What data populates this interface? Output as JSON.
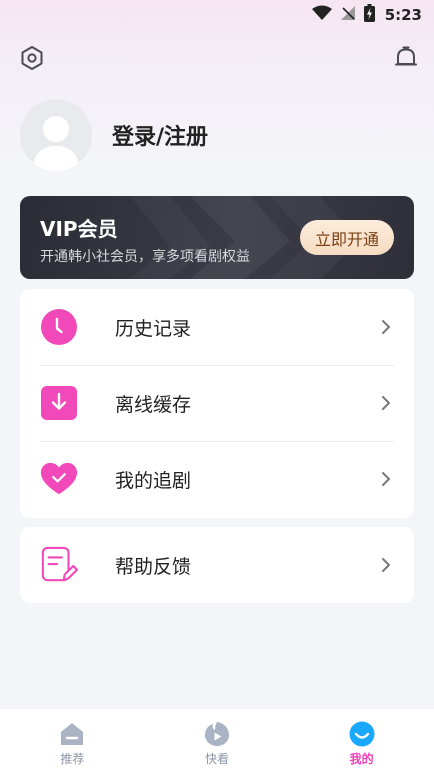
{
  "status_bar": {
    "time": "5:23"
  },
  "profile": {
    "login_label": "登录/注册"
  },
  "vip": {
    "title": "VIP会员",
    "description": "开通韩小社会员，享多项看剧权益",
    "button_label": "立即开通"
  },
  "menu": {
    "items": [
      {
        "label": "历史记录",
        "icon": "clock-icon"
      },
      {
        "label": "离线缓存",
        "icon": "download-icon"
      },
      {
        "label": "我的追剧",
        "icon": "heart-icon"
      }
    ],
    "help": {
      "label": "帮助反馈",
      "icon": "feedback-icon"
    }
  },
  "tabs": [
    {
      "label": "推荐",
      "icon": "home-icon",
      "active": false
    },
    {
      "label": "快看",
      "icon": "play-icon",
      "active": false
    },
    {
      "label": "我的",
      "icon": "profile-smile-icon",
      "active": true
    }
  ],
  "colors": {
    "accent": "#ef40b7",
    "vip_bg": "#2b2c35",
    "vip_button": "#f6dcc2",
    "page_bg": "#f4f5f8"
  }
}
